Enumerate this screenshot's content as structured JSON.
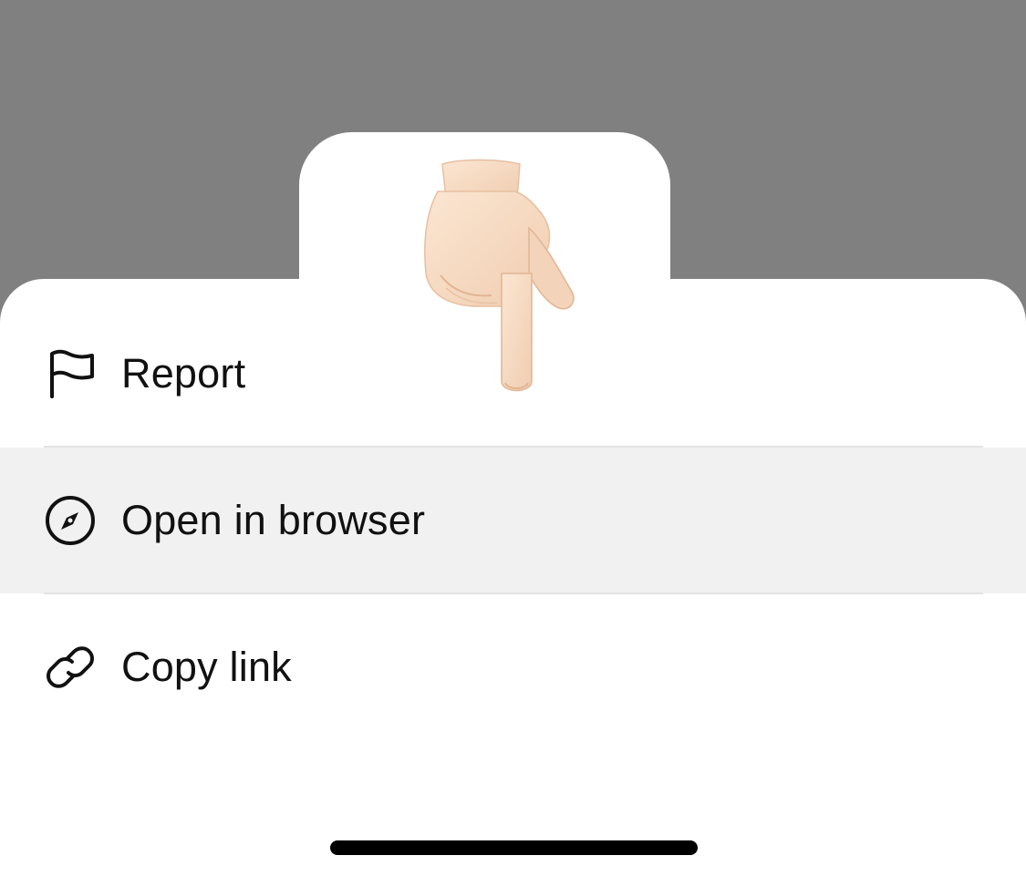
{
  "menu": {
    "items": [
      {
        "label": "Report",
        "icon": "flag-icon"
      },
      {
        "label": "Open in browser",
        "icon": "compass-icon"
      },
      {
        "label": "Copy link",
        "icon": "link-icon"
      }
    ],
    "highlighted_index": 1
  },
  "overlay": {
    "emoji": "backhand-index-pointing-down-icon"
  },
  "colors": {
    "backdrop": "#808080",
    "sheet": "#ffffff",
    "highlight": "#f1f1f1",
    "text": "#111111",
    "divider": "#e3e3e3",
    "home_indicator": "#000000",
    "emoji_skin": "#f6dcc4"
  }
}
